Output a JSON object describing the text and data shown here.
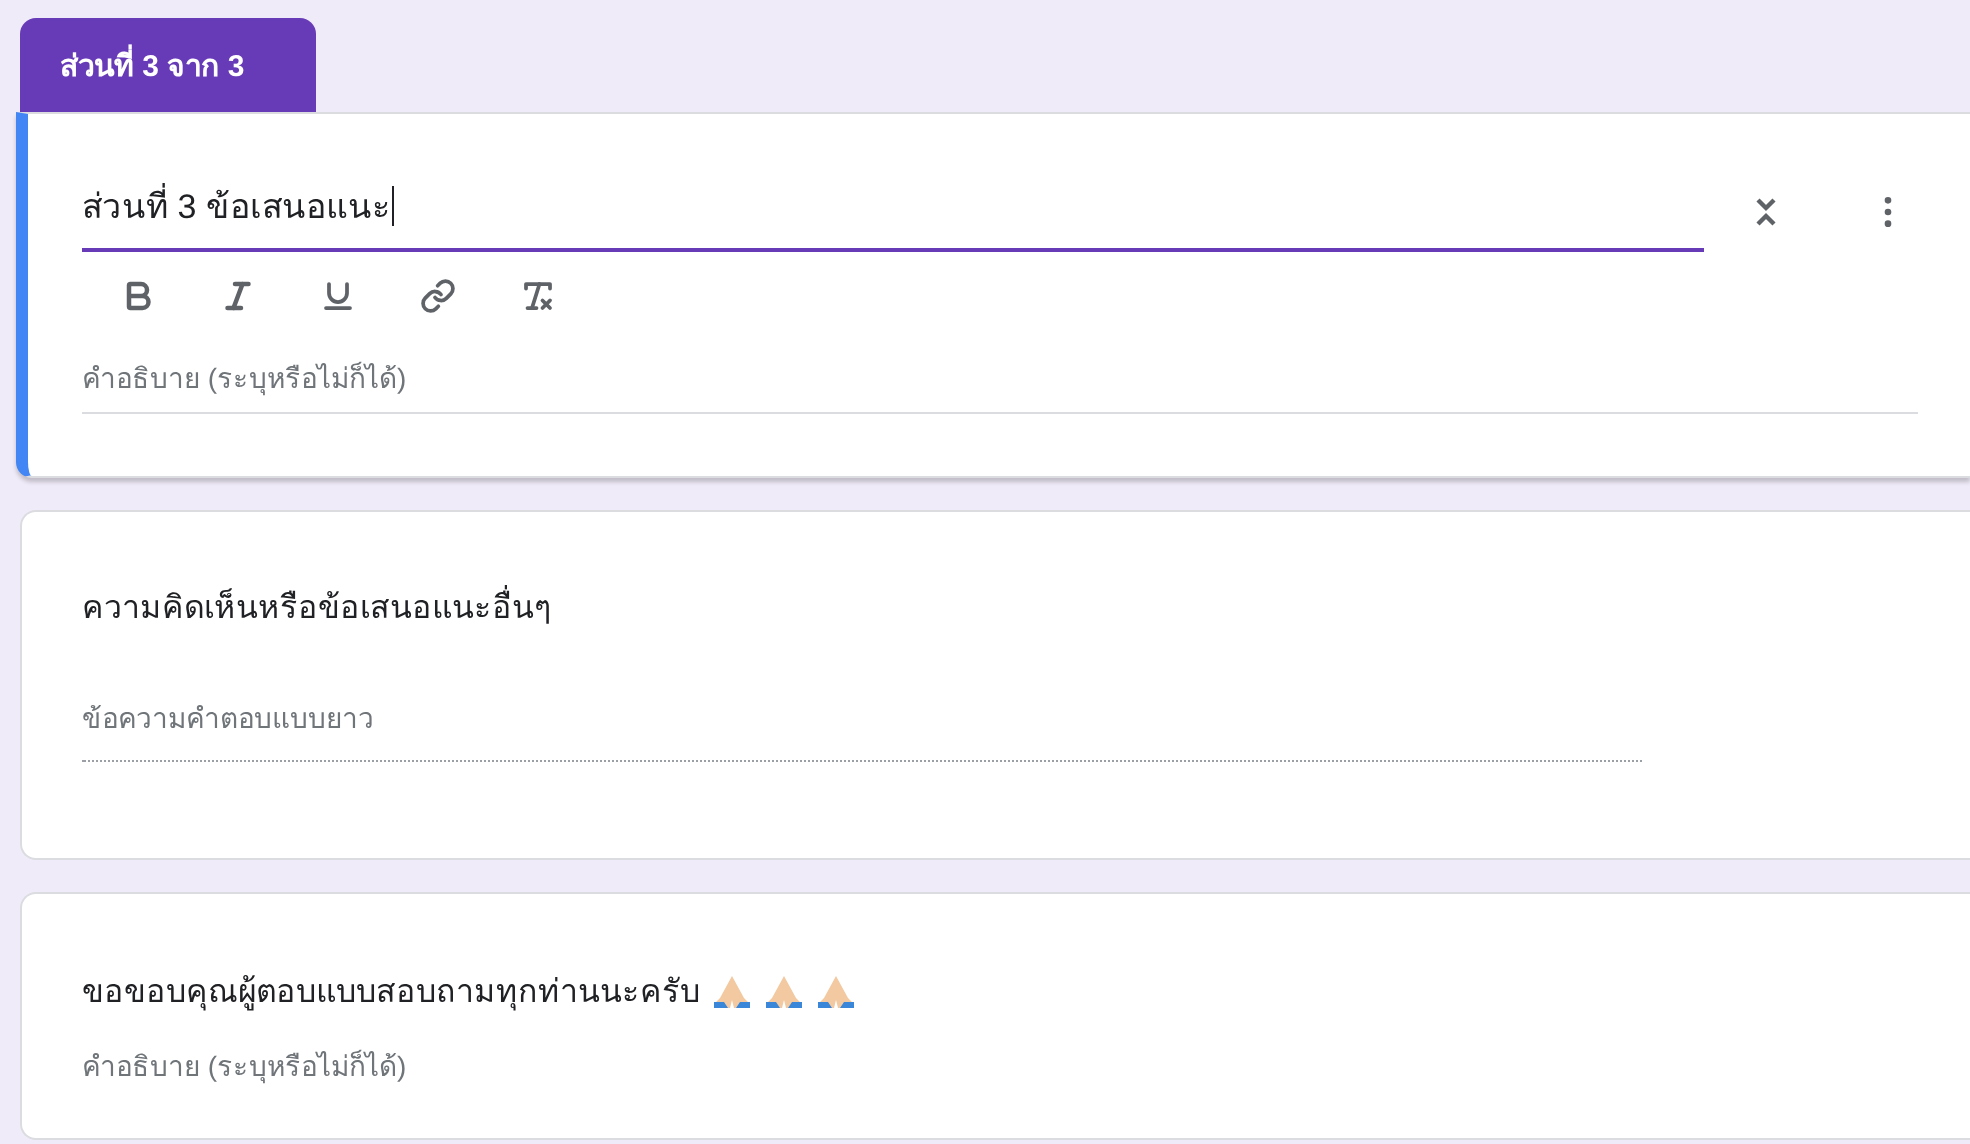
{
  "section_tab": {
    "label": "ส่วนที่ 3 จาก 3"
  },
  "section_header": {
    "title": "ส่วนที่ 3 ข้อเสนอแนะ",
    "focused": true,
    "description_placeholder": "คำอธิบาย (ระบุหรือไม่ก็ได้)"
  },
  "question": {
    "title": "ความคิดเห็นหรือข้อเสนอแนะอื่นๆ",
    "answer_placeholder": "ข้อความคำตอบแบบยาว"
  },
  "closing": {
    "title": "ขอขอบคุณผู้ตอบแบบสอบถามทุกท่านนะครับ",
    "description_placeholder": "คำอธิบาย (ระบุหรือไม่ก็ได้)"
  }
}
